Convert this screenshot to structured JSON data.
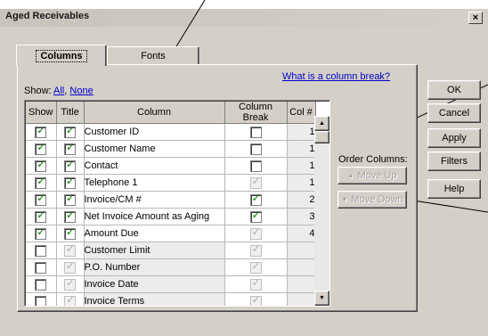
{
  "window": {
    "title": "Aged Receivables",
    "close_glyph": "×"
  },
  "tabs": [
    {
      "label": "Columns",
      "active": true
    },
    {
      "label": "Fonts",
      "active": false
    }
  ],
  "help_link": "What is a column break?",
  "show": {
    "label": "Show:",
    "all": "All",
    "sep": ",",
    "none": "None"
  },
  "grid": {
    "headers": [
      "Show",
      "Title",
      "Column",
      "Column Break",
      "Col #"
    ],
    "rows": [
      {
        "show": true,
        "title": true,
        "title_enabled": true,
        "column": "Customer ID",
        "break": false,
        "break_enabled": true,
        "col": "1"
      },
      {
        "show": true,
        "title": true,
        "title_enabled": true,
        "column": "Customer Name",
        "break": false,
        "break_enabled": true,
        "col": "1"
      },
      {
        "show": true,
        "title": true,
        "title_enabled": true,
        "column": "Contact",
        "break": false,
        "break_enabled": true,
        "col": "1"
      },
      {
        "show": true,
        "title": true,
        "title_enabled": true,
        "column": "Telephone 1",
        "break": true,
        "break_enabled": false,
        "col": "1"
      },
      {
        "show": true,
        "title": true,
        "title_enabled": true,
        "column": "Invoice/CM #",
        "break": true,
        "break_enabled": true,
        "col": "2"
      },
      {
        "show": true,
        "title": true,
        "title_enabled": true,
        "column": "Net Invoice Amount as Aging",
        "break": true,
        "break_enabled": true,
        "col": "3"
      },
      {
        "show": true,
        "title": true,
        "title_enabled": true,
        "column": "Amount Due",
        "break": true,
        "break_enabled": false,
        "col": "4"
      },
      {
        "show": false,
        "title": true,
        "title_enabled": false,
        "column": "Customer Limit",
        "break": true,
        "break_enabled": false,
        "col": ""
      },
      {
        "show": false,
        "title": true,
        "title_enabled": false,
        "column": "P.O. Number",
        "break": true,
        "break_enabled": false,
        "col": ""
      },
      {
        "show": false,
        "title": true,
        "title_enabled": false,
        "column": "Invoice Date",
        "break": true,
        "break_enabled": false,
        "col": ""
      },
      {
        "show": false,
        "title": true,
        "title_enabled": false,
        "column": "Invoice Terms",
        "break": true,
        "break_enabled": false,
        "col": ""
      }
    ]
  },
  "order_columns": {
    "label": "Order Columns:",
    "move_up": "Move Up",
    "move_down": "Move Down"
  },
  "buttons": {
    "ok": "OK",
    "cancel": "Cancel",
    "apply": "Apply",
    "filters": "Filters",
    "help": "Help"
  },
  "colors": {
    "face": "#d4d0c8",
    "link": "#0000cc",
    "check": "#008000"
  }
}
